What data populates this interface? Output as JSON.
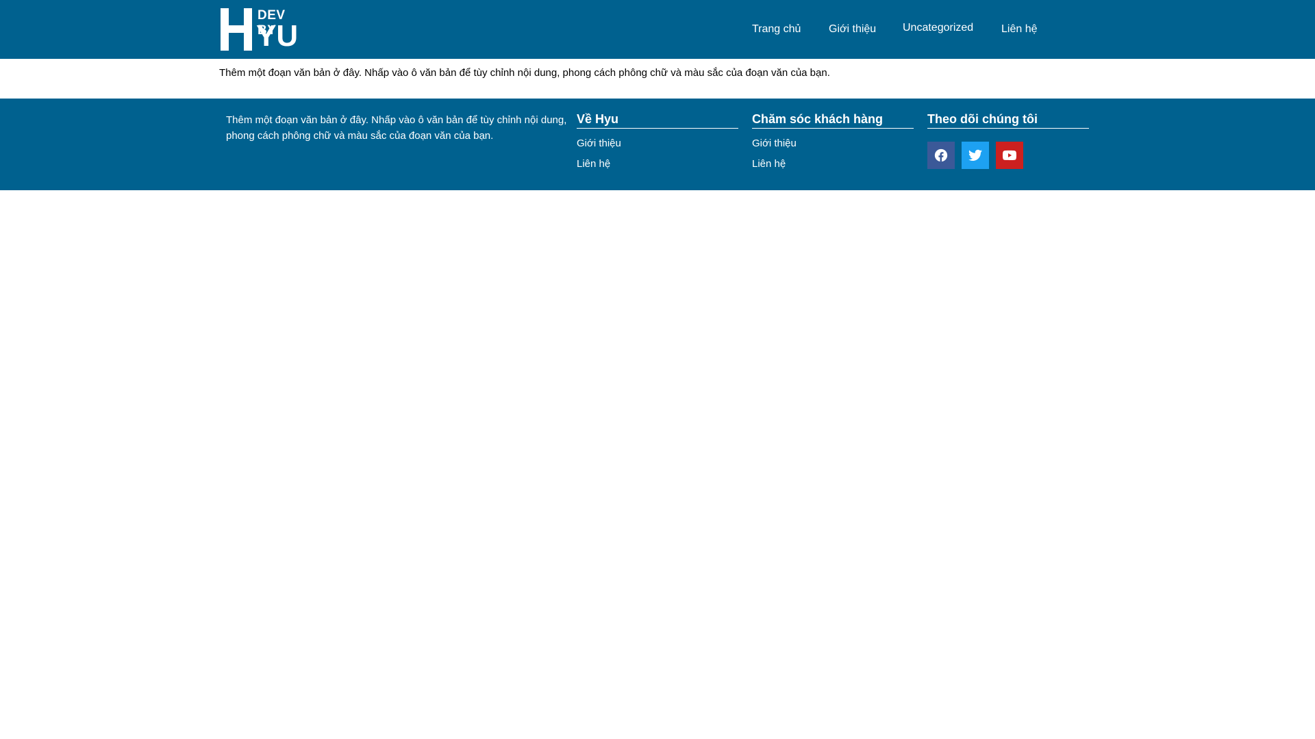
{
  "header": {
    "logo": {
      "line1": "DEV BY",
      "line2": "YU",
      "letter": "H"
    },
    "nav": [
      {
        "label": "Trang chủ"
      },
      {
        "label": "Giới thiệu"
      },
      {
        "label": "Uncategorized"
      },
      {
        "label": "Liên hệ"
      }
    ]
  },
  "main": {
    "intro": "Thêm một đoạn văn bản ở đây. Nhấp vào ô văn bản để tùy chỉnh nội dung, phong cách phông chữ và màu sắc của đoạn văn của bạn."
  },
  "footer": {
    "text": "Thêm một đoạn văn bản ở đây. Nhấp vào ô văn bản để tùy chỉnh nội dung, phong cách phông chữ và màu sắc của đoạn văn của bạn.",
    "about": {
      "title": "Về Hyu",
      "links": [
        "Giới thiệu",
        "Liên hệ"
      ]
    },
    "care": {
      "title": "Chăm sóc khách hàng",
      "links": [
        "Giới thiệu",
        "Liên hệ"
      ]
    },
    "follow": {
      "title": "Theo dõi chúng tôi",
      "socials": [
        {
          "icon": "facebook-icon",
          "color": "#3b5998"
        },
        {
          "icon": "twitter-icon",
          "color": "#1da1f2"
        },
        {
          "icon": "youtube-icon",
          "color": "#cd201f"
        }
      ]
    }
  },
  "colors": {
    "brand": "#00618f",
    "text_on_brand": "#ffffff"
  }
}
